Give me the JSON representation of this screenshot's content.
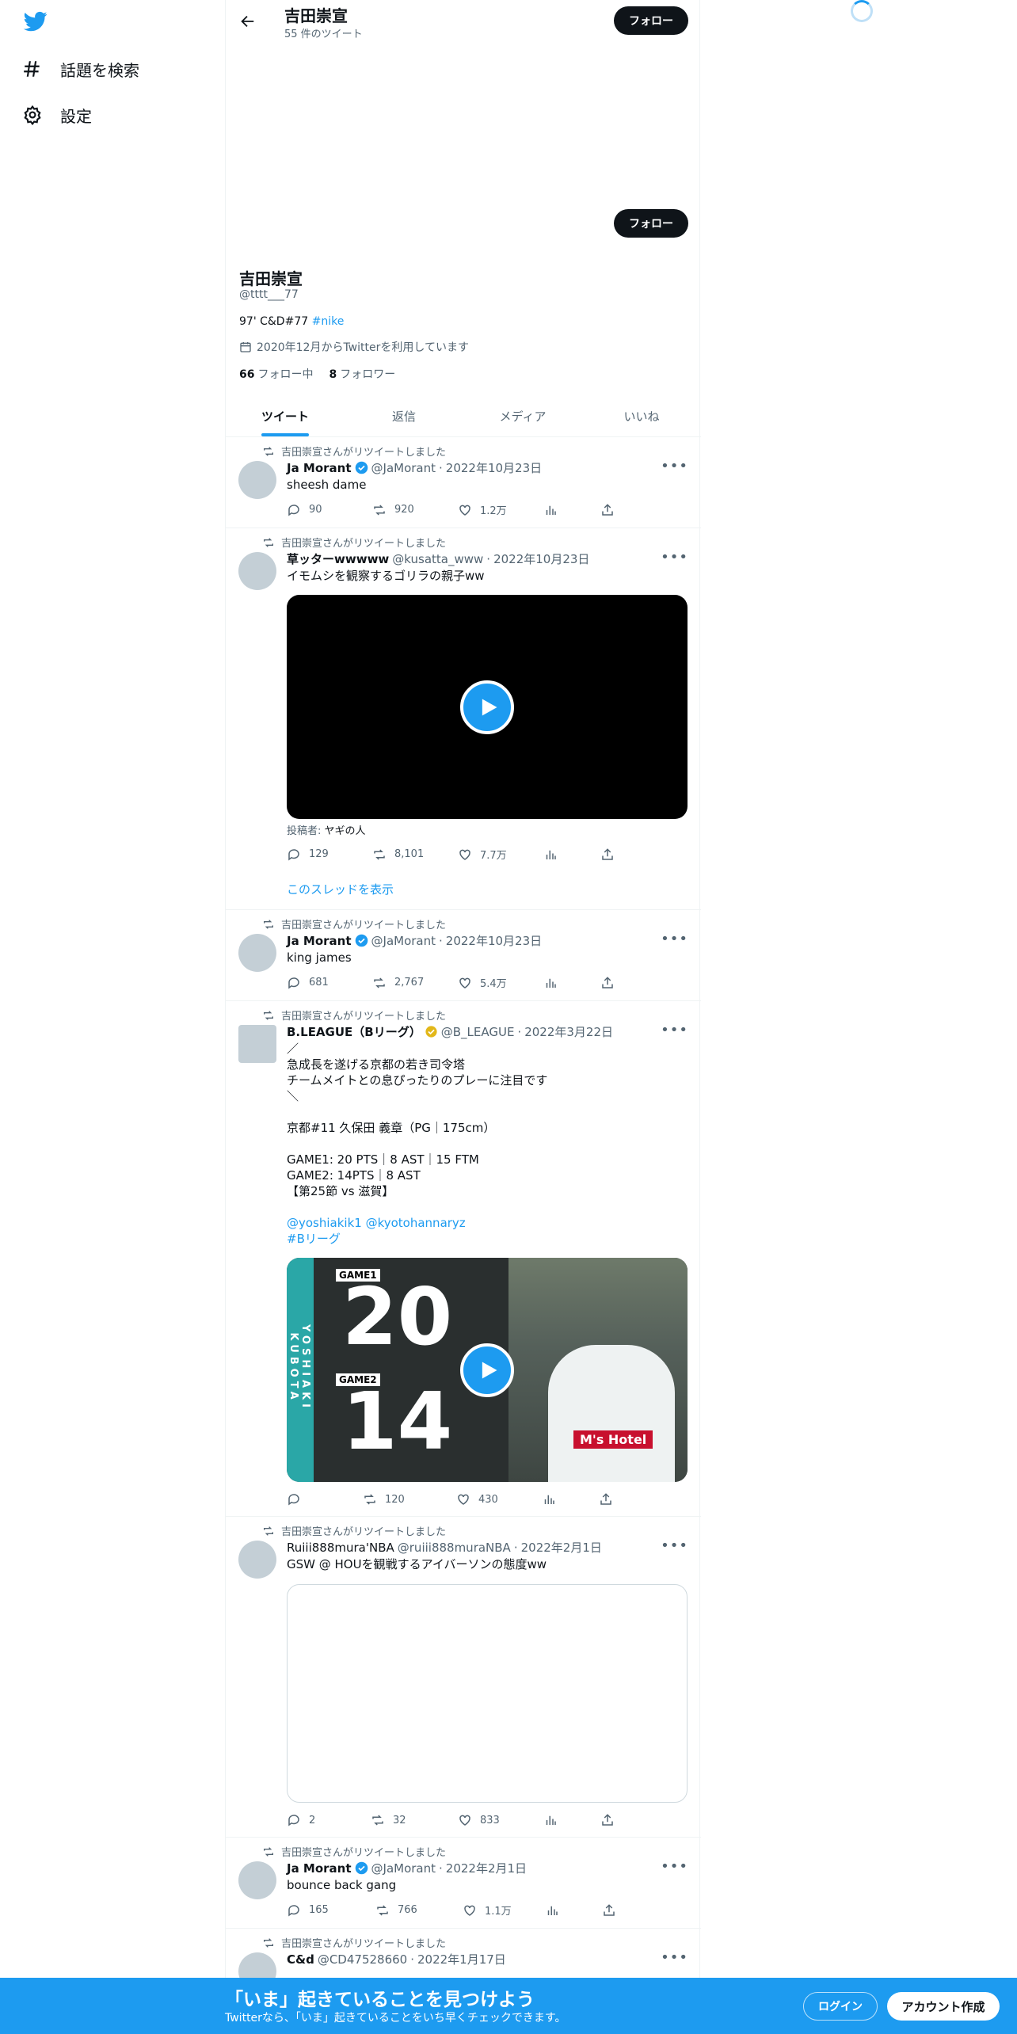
{
  "nav": {
    "explore": "話題を検索",
    "settings": "設定"
  },
  "header": {
    "name": "吉田崇宣",
    "tweet_count": "55 件のツイート",
    "follow": "フォロー"
  },
  "profile": {
    "name": "吉田崇宣",
    "handle": "@tttt___77",
    "bio_text": "97' C&D#77 ",
    "bio_tag": "#nike",
    "joined": "2020年12月からTwitterを利用しています",
    "following_count": "66",
    "following_label": "フォロー中",
    "followers_count": "8",
    "followers_label": "フォロワー",
    "follow": "フォロー"
  },
  "tabs": [
    "ツイート",
    "返信",
    "メディア",
    "いいね"
  ],
  "retweet_label": "吉田崇宣さんがリツイートしました",
  "tweets": [
    {
      "name": "Ja Morant",
      "handle": "@JaMorant",
      "date": "2022年10月23日",
      "text": "sheesh dame",
      "replies": "90",
      "retweets": "920",
      "likes": "1.2万"
    },
    {
      "name": "草ッターwwwww",
      "handle": "@kusatta_www",
      "date": "2022年10月23日",
      "text": "イモムシを観察するゴリラの親子ww",
      "poster_label": "投稿者:",
      "poster": "ヤギの人",
      "replies": "129",
      "retweets": "8,101",
      "likes": "7.7万",
      "thread": "このスレッドを表示"
    },
    {
      "name": "Ja Morant",
      "handle": "@JaMorant",
      "date": "2022年10月23日",
      "text": "king james",
      "replies": "681",
      "retweets": "2,767",
      "likes": "5.4万"
    },
    {
      "name": "B.LEAGUE（Bリーグ）",
      "handle": "@B_LEAGUE",
      "date": "2022年3月22日",
      "text": "／\n急成長を遂げる京都の若き司令塔\nチームメイトとの息ぴったりのプレーに注目です\n＼\n\n京都#11 久保田 義章（PG｜175cm）\n\nGAME1: 20 PTS｜8 AST｜15 FTM\nGAME2: 14PTS｜8 AST\n【第25節 vs 滋賀】",
      "mentions": "@yoshiakik1 @kyotohannaryz",
      "hashtag": "#Bリーグ",
      "media_game1": "GAME1",
      "media_game2": "GAME2",
      "media_n1": "20",
      "media_n2": "14",
      "media_side": "YOSHIAKI KUBOTA",
      "media_sponsor": "M's Hotel",
      "replies": "",
      "retweets": "120",
      "likes": "430"
    },
    {
      "name": "Ruiii888mura'NBA",
      "handle": "@ruiii888muraNBA",
      "date": "2022年2月1日",
      "text": "GSW @ HOUを観戦するアイバーソンの態度ww",
      "replies": "2",
      "retweets": "32",
      "likes": "833"
    },
    {
      "name": "Ja Morant",
      "handle": "@JaMorant",
      "date": "2022年2月1日",
      "text": "bounce back gang",
      "replies": "165",
      "retweets": "766",
      "likes": "1.1万"
    },
    {
      "name": "C&d",
      "handle": "@CD47528660",
      "date": "2022年1月17日"
    }
  ],
  "banner": {
    "title": "「いま」起きていることを見つけよう",
    "subtitle": "Twitterなら、「いま」起きていることをいち早くチェックできます。",
    "login": "ログイン",
    "signup": "アカウント作成"
  },
  "colors": {
    "accent": "#1d9bf0",
    "text": "#0f1419",
    "muted": "#536471"
  }
}
